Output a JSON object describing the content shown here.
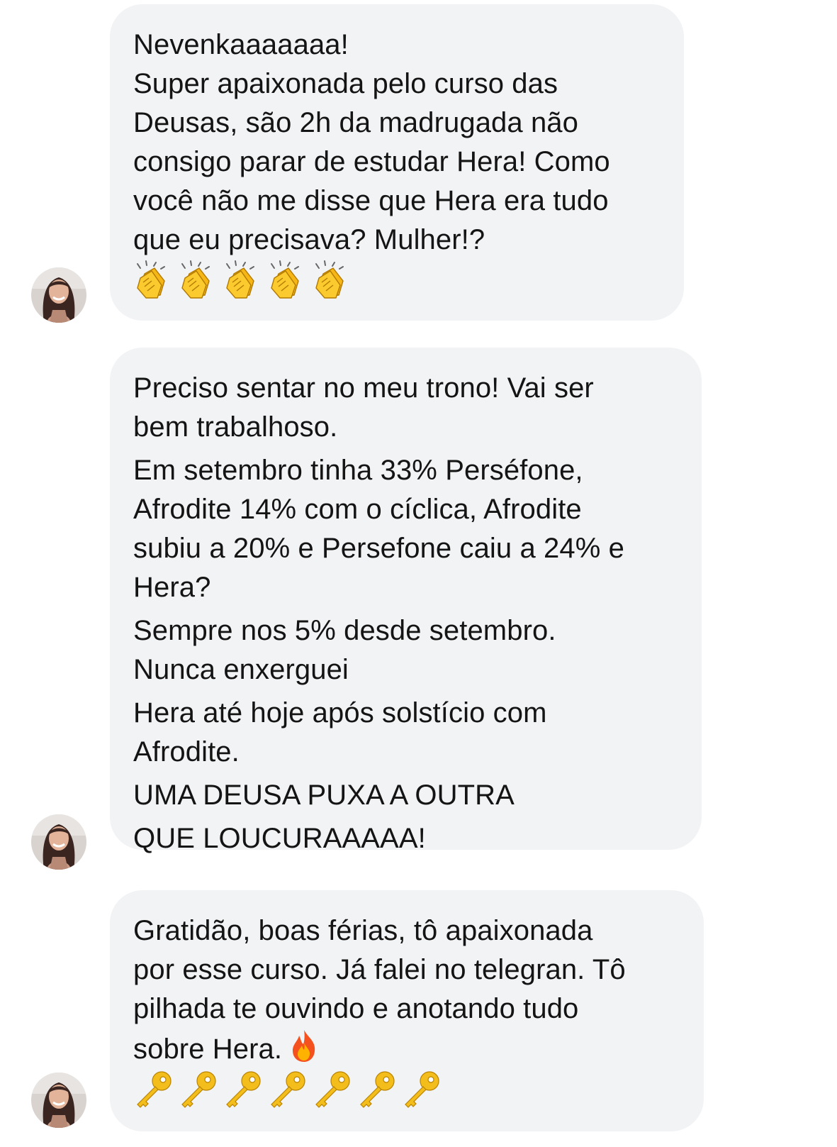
{
  "messages": [
    {
      "lines": [
        "Nevenkaaaaaaa!",
        "Super apaixonada pelo curso das",
        "Deusas, são 2h da madrugada não",
        "consigo parar de estudar Hera! Como",
        "você não me disse que Hera era tudo",
        "que eu precisava? Mulher!?"
      ],
      "emoji_icons": [
        "clapping-hands-icon",
        "clapping-hands-icon",
        "clapping-hands-icon",
        "clapping-hands-icon",
        "clapping-hands-icon"
      ]
    },
    {
      "lines": [
        "Preciso sentar no meu trono! Vai ser",
        "bem trabalhoso.",
        "Em setembro tinha 33% Perséfone,",
        "Afrodite 14% com o cíclica, Afrodite",
        "subiu a 20% e Persefone caiu a 24% e",
        "Hera?",
        "Sempre nos 5% desde setembro.",
        "Nunca enxerguei",
        "Hera até hoje após solstício com",
        "Afrodite.",
        "UMA DEUSA PUXA A OUTRA",
        "QUE LOUCURAAAAA!"
      ]
    },
    {
      "lines": [
        "Gratidão, boas férias,  tô apaixonada",
        "por esse curso. Já falei no telegran. Tô",
        "pilhada te ouvindo e anotando tudo",
        "sobre Hera."
      ],
      "inline_icon": "fire-icon",
      "emoji_icons": [
        "key-icon",
        "key-icon",
        "key-icon",
        "key-icon",
        "key-icon",
        "key-icon",
        "key-icon"
      ]
    }
  ],
  "colors": {
    "bubble": "#f2f3f5",
    "text": "#141414",
    "background": "#ffffff"
  }
}
